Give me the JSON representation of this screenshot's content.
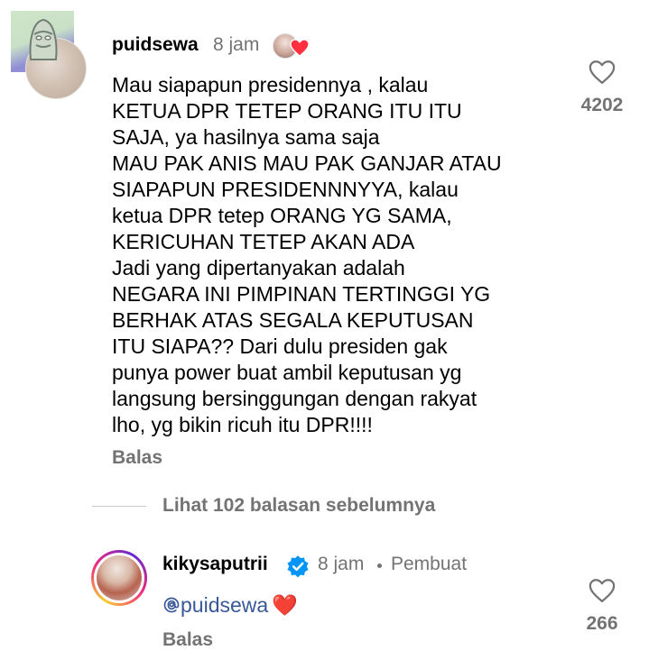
{
  "comment": {
    "username": "puidsewa",
    "time": "8 jam",
    "lines": [
      "Mau siapapun presidennya , kalau",
      "KETUA DPR TETEP ORANG ITU ITU",
      "SAJA, ya hasilnya sama saja",
      "MAU PAK ANIS MAU PAK GANJAR ATAU",
      "SIAPAPUN PRESIDENNNYYA, kalau",
      "ketua DPR tetep ORANG YG SAMA,",
      "KERICUHAN TETEP AKAN ADA",
      "Jadi yang dipertanyakan adalah",
      "NEGARA INI PIMPINAN TERTINGGI YG",
      "BERHAK ATAS SEGALA KEPUTUSAN",
      "ITU SIAPA?? Dari dulu presiden gak",
      "punya power buat ambil keputusan yg",
      "langsung bersinggungan dengan rakyat",
      "lho, yg bikin ricuh itu DPR!!!!"
    ],
    "reply_label": "Balas",
    "like_count": "4202",
    "icons": {
      "avatar": "user-avatar",
      "creator_like": "creator-liked-heart-icon",
      "like": "heart-outline-icon"
    }
  },
  "view_replies": "Lihat 102 balasan sebelumnya",
  "reply": {
    "username": "kikysaputrii",
    "time": "8 jam",
    "separator": "•",
    "badge": "Pembuat",
    "mention": "puidsewa",
    "emoji": "❤️",
    "reply_label": "Balas",
    "like_count": "266",
    "icons": {
      "verified": "verified-badge-icon",
      "mention": "threads-at-icon",
      "like": "heart-outline-icon"
    }
  },
  "colors": {
    "secondary_text": "#737373",
    "verified_blue": "#0095f6",
    "heart_red": "#ff3040",
    "mention": "#385898"
  }
}
